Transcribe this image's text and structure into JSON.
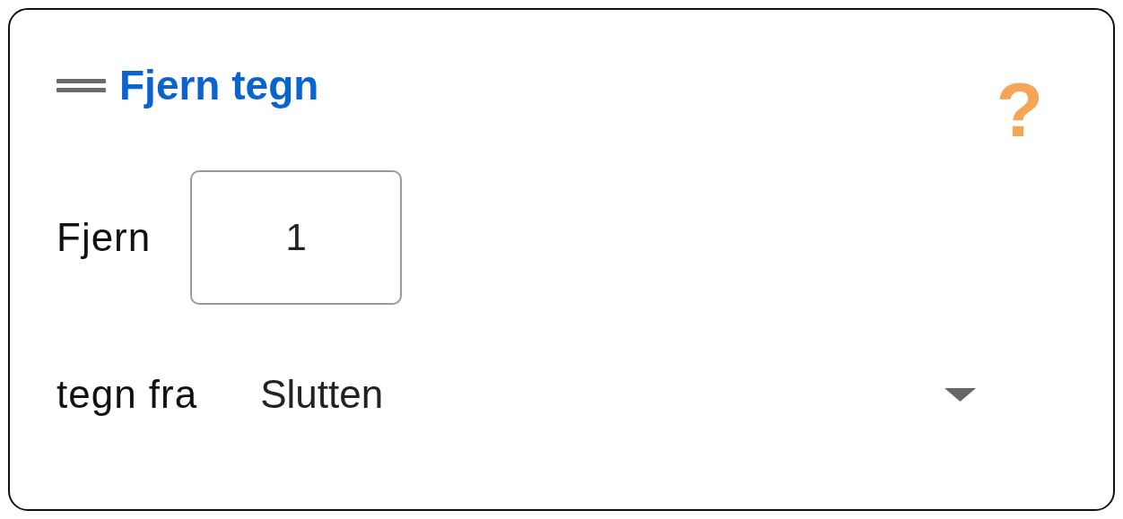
{
  "block": {
    "title": "Fjern tegn",
    "help": "?",
    "rows": [
      {
        "kind": "number",
        "label": "Fjern",
        "value": "1"
      },
      {
        "kind": "dropdown",
        "label": "tegn fra",
        "value": "Slutten"
      }
    ]
  }
}
